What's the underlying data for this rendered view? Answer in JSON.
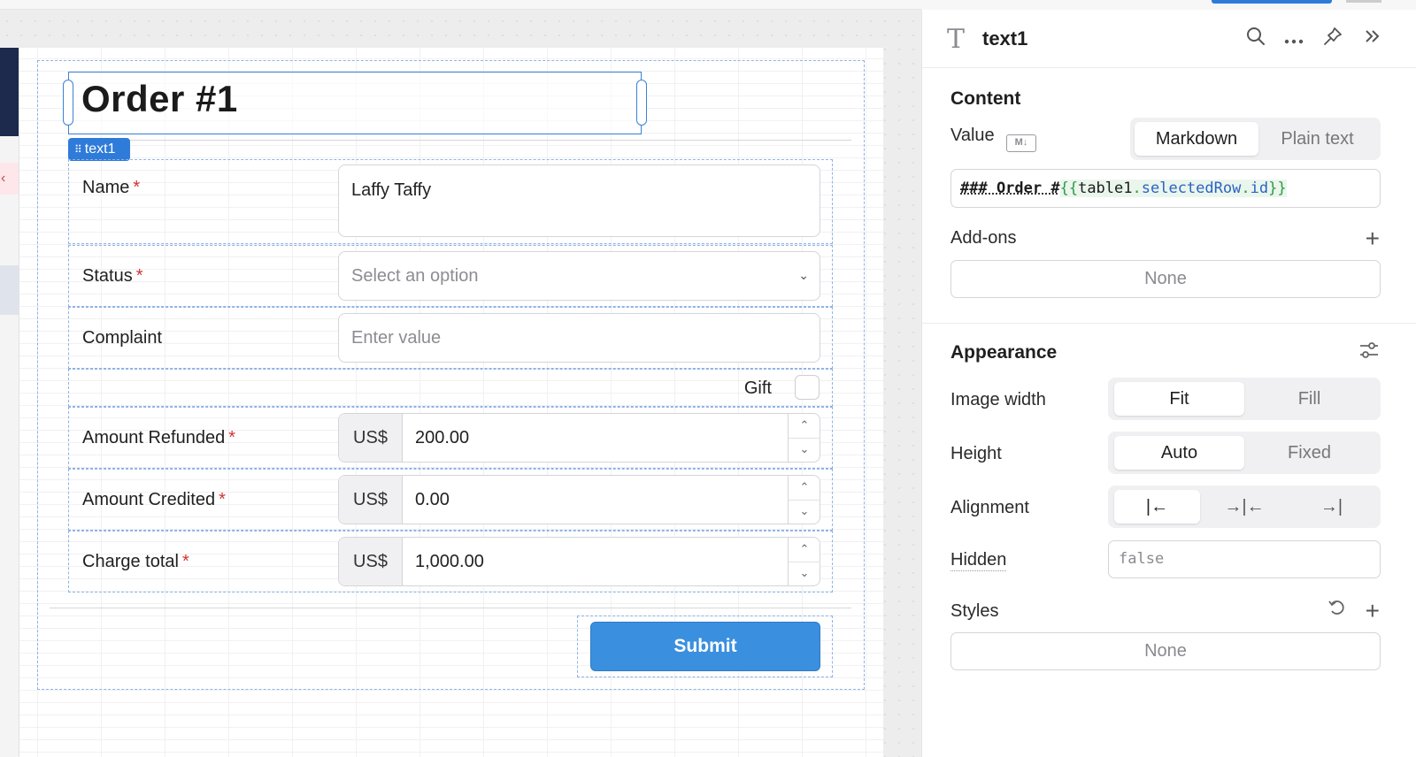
{
  "canvas": {
    "title": "Order #1",
    "selected_tag": "text1",
    "fields": [
      {
        "label": "Name",
        "required": true,
        "value": "Laffy Taffy",
        "placeholder": ""
      },
      {
        "label": "Status",
        "required": true,
        "value": "",
        "placeholder": "Select an option"
      },
      {
        "label": "Complaint",
        "required": false,
        "value": "",
        "placeholder": "Enter value"
      },
      {
        "label": "Amount Refunded",
        "required": true,
        "currency": "US$",
        "value": "200.00"
      },
      {
        "label": "Amount Credited",
        "required": true,
        "currency": "US$",
        "value": "0.00"
      },
      {
        "label": "Charge total",
        "required": true,
        "currency": "US$",
        "value": "1,000.00"
      }
    ],
    "gift_label": "Gift",
    "required_mark": "*",
    "submit_label": "Submit"
  },
  "inspector": {
    "component_name": "text1",
    "content": {
      "section_title": "Content",
      "value_label": "Value",
      "md_badge": "M↓",
      "mode_options": [
        "Markdown",
        "Plain text"
      ],
      "mode_selected": "Markdown",
      "code": {
        "heading": "### Order #",
        "open": "{{",
        "object": "table1",
        "dot1": ".",
        "prop1": "selectedRow",
        "dot2": ".",
        "prop2": "id",
        "close": "}}"
      },
      "addons_label": "Add-ons",
      "addons_value": "None"
    },
    "appearance": {
      "section_title": "Appearance",
      "image_width_label": "Image width",
      "image_width_options": [
        "Fit",
        "Fill"
      ],
      "image_width_selected": "Fit",
      "height_label": "Height",
      "height_options": [
        "Auto",
        "Fixed"
      ],
      "height_selected": "Auto",
      "alignment_label": "Alignment",
      "alignment_options": [
        "|←",
        "→|←",
        "→|"
      ],
      "alignment_selected": "left",
      "hidden_label": "Hidden",
      "hidden_value": "false",
      "styles_label": "Styles",
      "styles_value": "None"
    }
  },
  "colors": {
    "accent": "#2f7bd9",
    "submit": "#3a8fde",
    "required": "#d2332f",
    "selection": "#3b82d6"
  }
}
